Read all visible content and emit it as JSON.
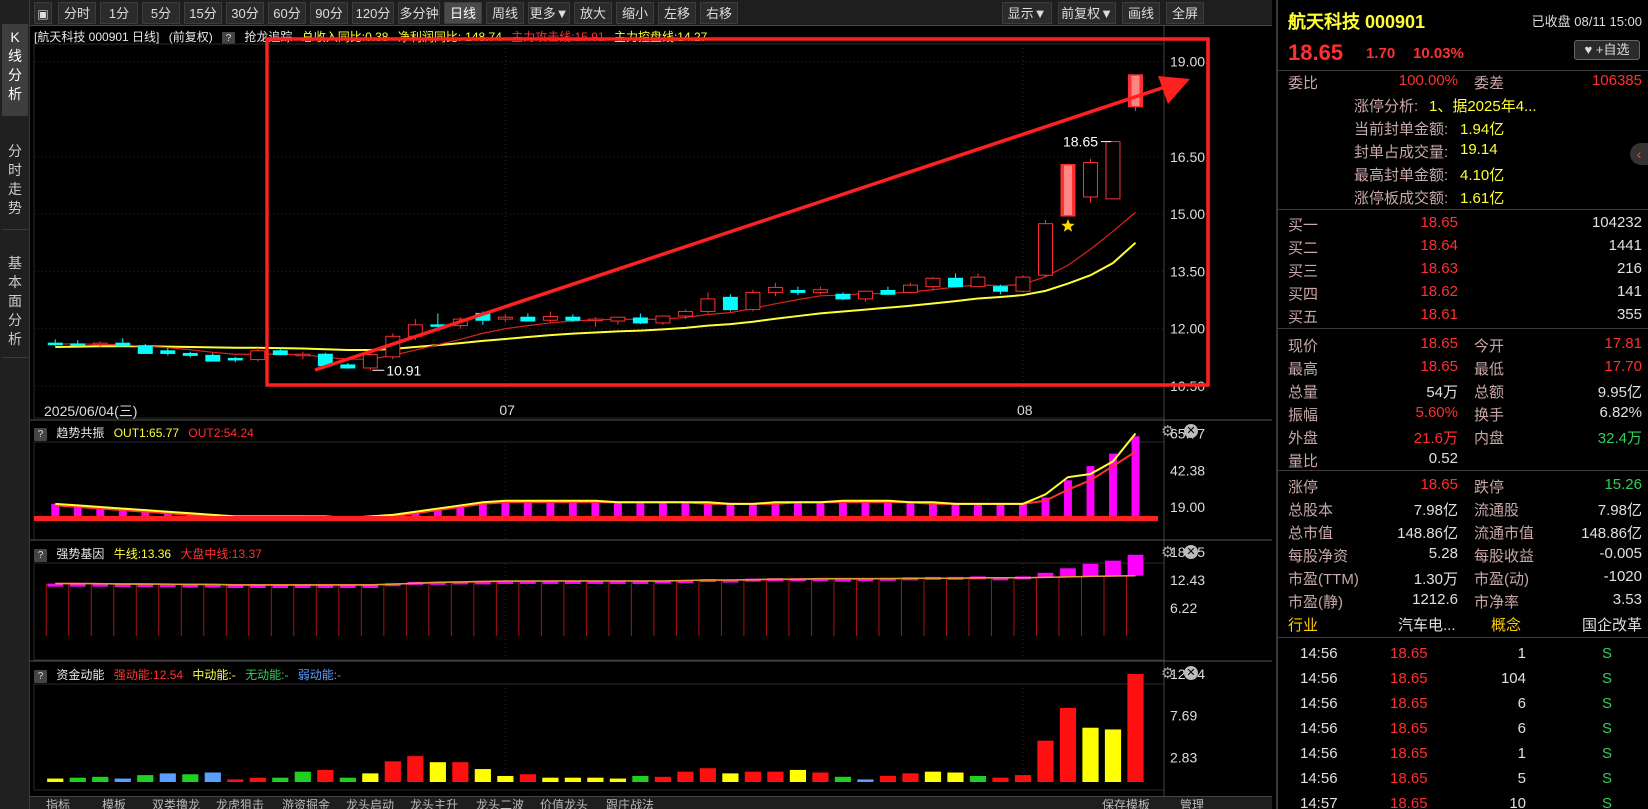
{
  "left_tabs": [
    {
      "label": "K\n线\n分\n析",
      "active": true
    },
    {
      "label": "分\n时\n走\n势",
      "active": false
    },
    {
      "label": "基\n本\n面\n分\n析",
      "active": false
    }
  ],
  "toolbar": {
    "left": [
      "分时",
      "1分",
      "5分",
      "15分",
      "30分",
      "60分",
      "90分",
      "120分",
      "多分钟",
      "日线",
      "周线",
      "更多▼",
      "放大",
      "缩小",
      "左移",
      "右移"
    ],
    "active": "日线",
    "right": [
      "显示▼",
      "前复权▼",
      "画线",
      "全屏"
    ]
  },
  "kline_info": {
    "title": "[航天科技 000901 日线]",
    "adjust": "(前复权)",
    "indicator": "抢龙追踪",
    "rev": "总收入同比:0.38",
    "profit": "净利润同比:-148.74",
    "main_attack": "主力攻击线:15.91",
    "main_control": "主力控盘线:14.27"
  },
  "panel_trend": {
    "name": "趋势共振",
    "out1": "OUT1:65.77",
    "out2": "OUT2:54.24",
    "ticks": [
      "65.77",
      "42.38",
      "19.00"
    ]
  },
  "panel_strong": {
    "name": "强势基因",
    "bull": "牛线:13.36",
    "market": "大盘中线:13.37",
    "ticks": [
      "18.65",
      "12.43",
      "6.22"
    ]
  },
  "panel_money": {
    "name": "资金动能",
    "strong": "强动能:12.54",
    "mid": "中动能:-",
    "none": "无动能:-",
    "weak": "弱动能:-",
    "ticks": [
      "12.54",
      "7.69",
      "2.83"
    ]
  },
  "bottom_tabs": [
    "指标",
    "模板",
    "双类撸龙",
    "龙虎狙击",
    "游资掘金",
    "龙头启动",
    "龙头主升",
    "龙头二波",
    "价值龙头",
    "跟庄战法",
    "保存模板",
    "管理"
  ],
  "chart_data": [
    {
      "type": "candlestick",
      "title": "航天科技 000901 日线",
      "ylim": [
        10.0,
        19.3
      ],
      "yticks": [
        "19.00",
        "16.50",
        "15.00",
        "13.50",
        "12.00",
        "10.50"
      ],
      "x_labels": [
        {
          "label": "2025/06/04(三)",
          "index": 0
        },
        {
          "label": "07",
          "index": 20
        },
        {
          "label": "08",
          "index": 43
        }
      ],
      "annotations": [
        {
          "text": "18.65",
          "index": 47
        },
        {
          "text": "10.91",
          "index": 14
        }
      ],
      "ohlc": [
        [
          11.62,
          11.72,
          11.55,
          11.6
        ],
        [
          11.6,
          11.7,
          11.52,
          11.58
        ],
        [
          11.58,
          11.66,
          11.5,
          11.62
        ],
        [
          11.62,
          11.75,
          11.53,
          11.55
        ],
        [
          11.55,
          11.6,
          11.4,
          11.35
        ],
        [
          11.42,
          11.5,
          11.3,
          11.35
        ],
        [
          11.35,
          11.4,
          11.25,
          11.3
        ],
        [
          11.3,
          11.36,
          11.15,
          11.15
        ],
        [
          11.22,
          11.26,
          11.12,
          11.19
        ],
        [
          11.19,
          11.5,
          11.14,
          11.42
        ],
        [
          11.42,
          11.48,
          11.3,
          11.32
        ],
        [
          11.32,
          11.4,
          11.2,
          11.33
        ],
        [
          11.33,
          11.37,
          10.98,
          11.03
        ],
        [
          11.05,
          11.1,
          10.95,
          10.97
        ],
        [
          10.97,
          11.4,
          10.91,
          11.32
        ],
        [
          11.26,
          11.88,
          11.2,
          11.8
        ],
        [
          11.8,
          12.25,
          11.7,
          12.1
        ],
        [
          12.1,
          12.4,
          11.95,
          12.08
        ],
        [
          12.08,
          12.3,
          12.0,
          12.25
        ],
        [
          12.4,
          12.45,
          12.1,
          12.22
        ],
        [
          12.25,
          12.38,
          12.18,
          12.3
        ],
        [
          12.3,
          12.4,
          12.2,
          12.2
        ],
        [
          12.22,
          12.45,
          12.15,
          12.32
        ],
        [
          12.3,
          12.38,
          12.18,
          12.22
        ],
        [
          12.22,
          12.3,
          12.05,
          12.25
        ],
        [
          12.2,
          12.32,
          12.1,
          12.3
        ],
        [
          12.28,
          12.4,
          12.12,
          12.15
        ],
        [
          12.15,
          12.35,
          12.1,
          12.33
        ],
        [
          12.33,
          12.5,
          12.25,
          12.45
        ],
        [
          12.45,
          12.95,
          12.4,
          12.78
        ],
        [
          12.82,
          12.9,
          12.45,
          12.5
        ],
        [
          12.5,
          13.02,
          12.45,
          12.95
        ],
        [
          12.95,
          13.2,
          12.85,
          13.08
        ],
        [
          13.0,
          13.1,
          12.88,
          12.95
        ],
        [
          12.95,
          13.1,
          12.9,
          13.02
        ],
        [
          12.9,
          12.95,
          12.75,
          12.78
        ],
        [
          12.78,
          13.0,
          12.7,
          12.98
        ],
        [
          13.0,
          13.1,
          12.9,
          12.9
        ],
        [
          12.95,
          13.2,
          12.92,
          13.14
        ],
        [
          13.1,
          13.35,
          13.0,
          13.32
        ],
        [
          13.32,
          13.45,
          13.2,
          13.1
        ],
        [
          13.1,
          13.45,
          13.1,
          13.35
        ],
        [
          13.1,
          13.15,
          12.9,
          12.98
        ],
        [
          12.98,
          13.4,
          12.95,
          13.35
        ],
        [
          13.4,
          14.85,
          13.35,
          14.75
        ],
        [
          16.3,
          16.3,
          14.95,
          14.95
        ],
        [
          15.45,
          16.45,
          15.3,
          16.35
        ],
        [
          15.4,
          16.9,
          15.4,
          16.9
        ],
        [
          17.81,
          18.65,
          17.7,
          18.65
        ]
      ],
      "ma_short": [
        11.6,
        11.6,
        11.59,
        11.58,
        11.54,
        11.5,
        11.45,
        11.38,
        11.33,
        11.33,
        11.33,
        11.32,
        11.25,
        11.2,
        11.2,
        11.3,
        11.44,
        11.58,
        11.72,
        11.88,
        12.0,
        12.08,
        12.15,
        12.2,
        12.23,
        12.25,
        12.24,
        12.25,
        12.29,
        12.37,
        12.42,
        12.53,
        12.65,
        12.76,
        12.86,
        12.88,
        12.92,
        12.92,
        12.96,
        13.02,
        13.09,
        13.15,
        13.12,
        13.16,
        13.36,
        13.66,
        14.08,
        14.55,
        15.05
      ],
      "ma_long": [
        11.52,
        11.53,
        11.54,
        11.54,
        11.54,
        11.53,
        11.52,
        11.51,
        11.5,
        11.5,
        11.49,
        11.48,
        11.46,
        11.44,
        11.44,
        11.47,
        11.52,
        11.57,
        11.62,
        11.68,
        11.73,
        11.78,
        11.83,
        11.87,
        11.9,
        11.93,
        11.95,
        11.98,
        12.02,
        12.08,
        12.12,
        12.18,
        12.26,
        12.33,
        12.4,
        12.45,
        12.5,
        12.55,
        12.6,
        12.66,
        12.72,
        12.79,
        12.83,
        12.88,
        12.99,
        13.18,
        13.4,
        13.72,
        14.25
      ]
    },
    {
      "type": "bar",
      "title": "趋势共振",
      "ylim": [
        12,
        68
      ],
      "bar_values": [
        21,
        20,
        19,
        18,
        17,
        16,
        15,
        14,
        13,
        13,
        13,
        13,
        13,
        12,
        13,
        14,
        16,
        18,
        20,
        22,
        23,
        23,
        23,
        23,
        23,
        22,
        22,
        22,
        22,
        22,
        21,
        21,
        22,
        22,
        22,
        23,
        23,
        23,
        22,
        22,
        21,
        21,
        21,
        21,
        25,
        36,
        45,
        53,
        64
      ],
      "out1": [
        21,
        20,
        19,
        18,
        17,
        16,
        15,
        14,
        13,
        13,
        13,
        13,
        13,
        12,
        13,
        14,
        16,
        18,
        20,
        22,
        23,
        23,
        23,
        23,
        23,
        22,
        22,
        22,
        22,
        22,
        21,
        21,
        22,
        22,
        22,
        23,
        23,
        23,
        22,
        22,
        21,
        21,
        21,
        21,
        27,
        38,
        40,
        48,
        65.77
      ],
      "out2": [
        20,
        19,
        18,
        17,
        16,
        15,
        14,
        13,
        13,
        13,
        13,
        13,
        12,
        12,
        12,
        13,
        15,
        17,
        19,
        21,
        22,
        22,
        22,
        22,
        22,
        22,
        22,
        22,
        22,
        21,
        21,
        21,
        21,
        22,
        22,
        22,
        22,
        22,
        22,
        21,
        21,
        21,
        21,
        21,
        23,
        30,
        36,
        45,
        54.24
      ]
    },
    {
      "type": "bar",
      "title": "强势基因",
      "ylim": [
        0,
        19.5
      ],
      "bar_values": [
        11.5,
        11.5,
        11.5,
        11.5,
        11.4,
        11.3,
        11.3,
        11.2,
        11.2,
        11.3,
        11.3,
        11.3,
        11.1,
        11.0,
        11.2,
        11.7,
        12.0,
        12.0,
        12.1,
        12.1,
        12.2,
        12.2,
        12.2,
        12.2,
        12.2,
        12.2,
        12.2,
        12.3,
        12.4,
        12.6,
        12.5,
        12.7,
        12.8,
        12.8,
        12.8,
        12.7,
        12.8,
        12.9,
        13.0,
        13.1,
        13.1,
        13.2,
        13.0,
        13.2,
        14.0,
        15.0,
        16.0,
        16.7,
        18.0
      ],
      "bull": [
        11.6,
        11.6,
        11.6,
        11.5,
        11.5,
        11.5,
        11.4,
        11.4,
        11.3,
        11.3,
        11.3,
        11.3,
        11.3,
        11.3,
        11.3,
        11.5,
        11.7,
        11.9,
        12.0,
        12.1,
        12.2,
        12.2,
        12.2,
        12.2,
        12.2,
        12.2,
        12.2,
        12.2,
        12.3,
        12.4,
        12.4,
        12.5,
        12.6,
        12.6,
        12.7,
        12.7,
        12.7,
        12.7,
        12.8,
        12.8,
        12.8,
        12.9,
        12.9,
        12.9,
        13.0,
        13.1,
        13.2,
        13.3,
        13.36
      ],
      "market": [
        11.7,
        11.7,
        11.6,
        11.6,
        11.6,
        11.5,
        11.5,
        11.5,
        11.4,
        11.4,
        11.4,
        11.4,
        11.4,
        11.4,
        11.4,
        11.5,
        11.6,
        11.8,
        11.9,
        12.0,
        12.1,
        12.1,
        12.2,
        12.2,
        12.2,
        12.2,
        12.2,
        12.2,
        12.3,
        12.3,
        12.4,
        12.4,
        12.5,
        12.5,
        12.6,
        12.6,
        12.6,
        12.7,
        12.7,
        12.8,
        12.8,
        12.8,
        12.9,
        12.9,
        13.0,
        13.1,
        13.2,
        13.3,
        13.37
      ]
    },
    {
      "type": "bar",
      "title": "资金动能",
      "ylim": [
        0,
        13
      ],
      "bar_values": [
        0.4,
        0.5,
        0.6,
        0.4,
        0.8,
        1.0,
        0.9,
        1.1,
        0.3,
        0.5,
        0.5,
        1.2,
        1.4,
        0.5,
        1.0,
        2.4,
        3.0,
        2.3,
        2.3,
        1.5,
        0.7,
        0.9,
        0.5,
        0.5,
        0.5,
        0.4,
        0.7,
        0.6,
        1.2,
        1.6,
        1.0,
        1.2,
        1.2,
        1.4,
        1.1,
        0.6,
        0.3,
        0.7,
        1.0,
        1.2,
        1.1,
        0.7,
        0.5,
        0.8,
        4.8,
        8.6,
        6.3,
        6.1,
        12.54
      ],
      "bar_colors": [
        "y",
        "g",
        "g",
        "b",
        "g",
        "b",
        "g",
        "b",
        "r",
        "r",
        "g",
        "g",
        "r",
        "g",
        "y",
        "r",
        "r",
        "y",
        "r",
        "y",
        "y",
        "r",
        "y",
        "y",
        "y",
        "y",
        "g",
        "r",
        "r",
        "r",
        "y",
        "r",
        "r",
        "y",
        "r",
        "g",
        "b",
        "r",
        "r",
        "y",
        "y",
        "g",
        "r",
        "r",
        "r",
        "r",
        "y",
        "y",
        "r"
      ]
    }
  ],
  "quote": {
    "name": "航天科技 000901",
    "status": "已收盘 08/11 15:00",
    "price": "18.65",
    "change": "1.70",
    "pct": "10.03%",
    "fav": "+自选",
    "webi_label": "委比",
    "webi": "100.00%",
    "weicha_label": "委差",
    "weicha": "106385",
    "limit_items": [
      {
        "label": "涨停分析:",
        "value": "1、据2025年4..."
      },
      {
        "label": "当前封单金额:",
        "value": "1.94亿"
      },
      {
        "label": "封单占成交量:",
        "value": "19.14"
      },
      {
        "label": "最高封单金额:",
        "value": "4.10亿"
      },
      {
        "label": "涨停板成交额:",
        "value": "1.61亿"
      }
    ],
    "bids": [
      {
        "label": "买一",
        "price": "18.65",
        "vol": "104232"
      },
      {
        "label": "买二",
        "price": "18.64",
        "vol": "1441"
      },
      {
        "label": "买三",
        "price": "18.63",
        "vol": "216"
      },
      {
        "label": "买四",
        "price": "18.62",
        "vol": "141"
      },
      {
        "label": "买五",
        "price": "18.61",
        "vol": "355"
      }
    ],
    "stats1": [
      {
        "l1": "现价",
        "v1": "18.65",
        "c1": "red",
        "l2": "今开",
        "v2": "17.81",
        "c2": "red"
      },
      {
        "l1": "最高",
        "v1": "18.65",
        "c1": "red",
        "l2": "最低",
        "v2": "17.70",
        "c2": "red"
      },
      {
        "l1": "总量",
        "v1": "54万",
        "c1": "white",
        "l2": "总额",
        "v2": "9.95亿",
        "c2": "white"
      },
      {
        "l1": "振幅",
        "v1": "5.60%",
        "c1": "red",
        "l2": "换手",
        "v2": "6.82%",
        "c2": "white"
      },
      {
        "l1": "外盘",
        "v1": "21.6万",
        "c1": "red",
        "l2": "内盘",
        "v2": "32.4万",
        "c2": "green"
      },
      {
        "l1": "量比",
        "v1": "0.52",
        "c1": "white",
        "l2": "",
        "v2": "",
        "c2": "white"
      }
    ],
    "stats2": [
      {
        "l1": "涨停",
        "v1": "18.65",
        "c1": "red",
        "l2": "跌停",
        "v2": "15.26",
        "c2": "green"
      },
      {
        "l1": "总股本",
        "v1": "7.98亿",
        "c1": "white",
        "l2": "流通股",
        "v2": "7.98亿",
        "c2": "white"
      },
      {
        "l1": "总市值",
        "v1": "148.86亿",
        "c1": "white",
        "l2": "流通市值",
        "v2": "148.86亿",
        "c2": "white"
      },
      {
        "l1": "每股净资",
        "v1": "5.28",
        "c1": "white",
        "l2": "每股收益",
        "v2": "-0.005",
        "c2": "white"
      },
      {
        "l1": "市盈(TTM)",
        "v1": "1.30万",
        "c1": "white",
        "l2": "市盈(动)",
        "v2": "-1020",
        "c2": "white"
      },
      {
        "l1": "市盈(静)",
        "v1": "1212.6",
        "c1": "white",
        "l2": "市净率",
        "v2": "3.53",
        "c2": "white"
      }
    ],
    "industry_label": "行业",
    "industry": "汽车电...",
    "concept_label": "概念",
    "concept": "国企改革",
    "ticks": [
      {
        "time": "14:56",
        "price": "18.65",
        "vol": "1",
        "side": "S"
      },
      {
        "time": "14:56",
        "price": "18.65",
        "vol": "104",
        "side": "S"
      },
      {
        "time": "14:56",
        "price": "18.65",
        "vol": "6",
        "side": "S"
      },
      {
        "time": "14:56",
        "price": "18.65",
        "vol": "6",
        "side": "S"
      },
      {
        "time": "14:56",
        "price": "18.65",
        "vol": "1",
        "side": "S"
      },
      {
        "time": "14:56",
        "price": "18.65",
        "vol": "5",
        "side": "S"
      },
      {
        "time": "14:57",
        "price": "18.65",
        "vol": "10",
        "side": "S"
      }
    ]
  },
  "colors": {
    "red": "#ff3030",
    "green": "#2fd05a",
    "white": "#e0e0e0",
    "yellow": "#ffff33",
    "cyan": "#00ffff",
    "magenta": "#ff00ff",
    "label": "#c8a8a8"
  }
}
